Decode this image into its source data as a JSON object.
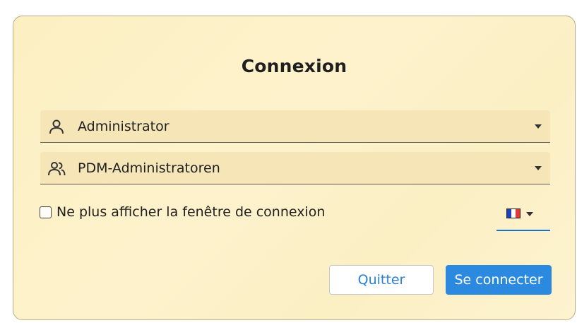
{
  "dialog": {
    "title": "Connexion",
    "user_select": {
      "value": "Administrator",
      "icon": "user-icon"
    },
    "group_select": {
      "value": "PDM-Administratoren",
      "icon": "users-group-icon"
    },
    "hide_dialog_checkbox": {
      "label": "Ne plus afficher la fenêtre de connexion",
      "checked": false
    },
    "language_select": {
      "icon": "french-flag-icon",
      "flag_colors": [
        "#1f3fbf",
        "#ffffff",
        "#e53935"
      ]
    },
    "buttons": {
      "quit_label": "Quitter",
      "connect_label": "Se connecter"
    }
  },
  "colors": {
    "accent": "#2b8ae0",
    "background": "#fcf0c2"
  }
}
